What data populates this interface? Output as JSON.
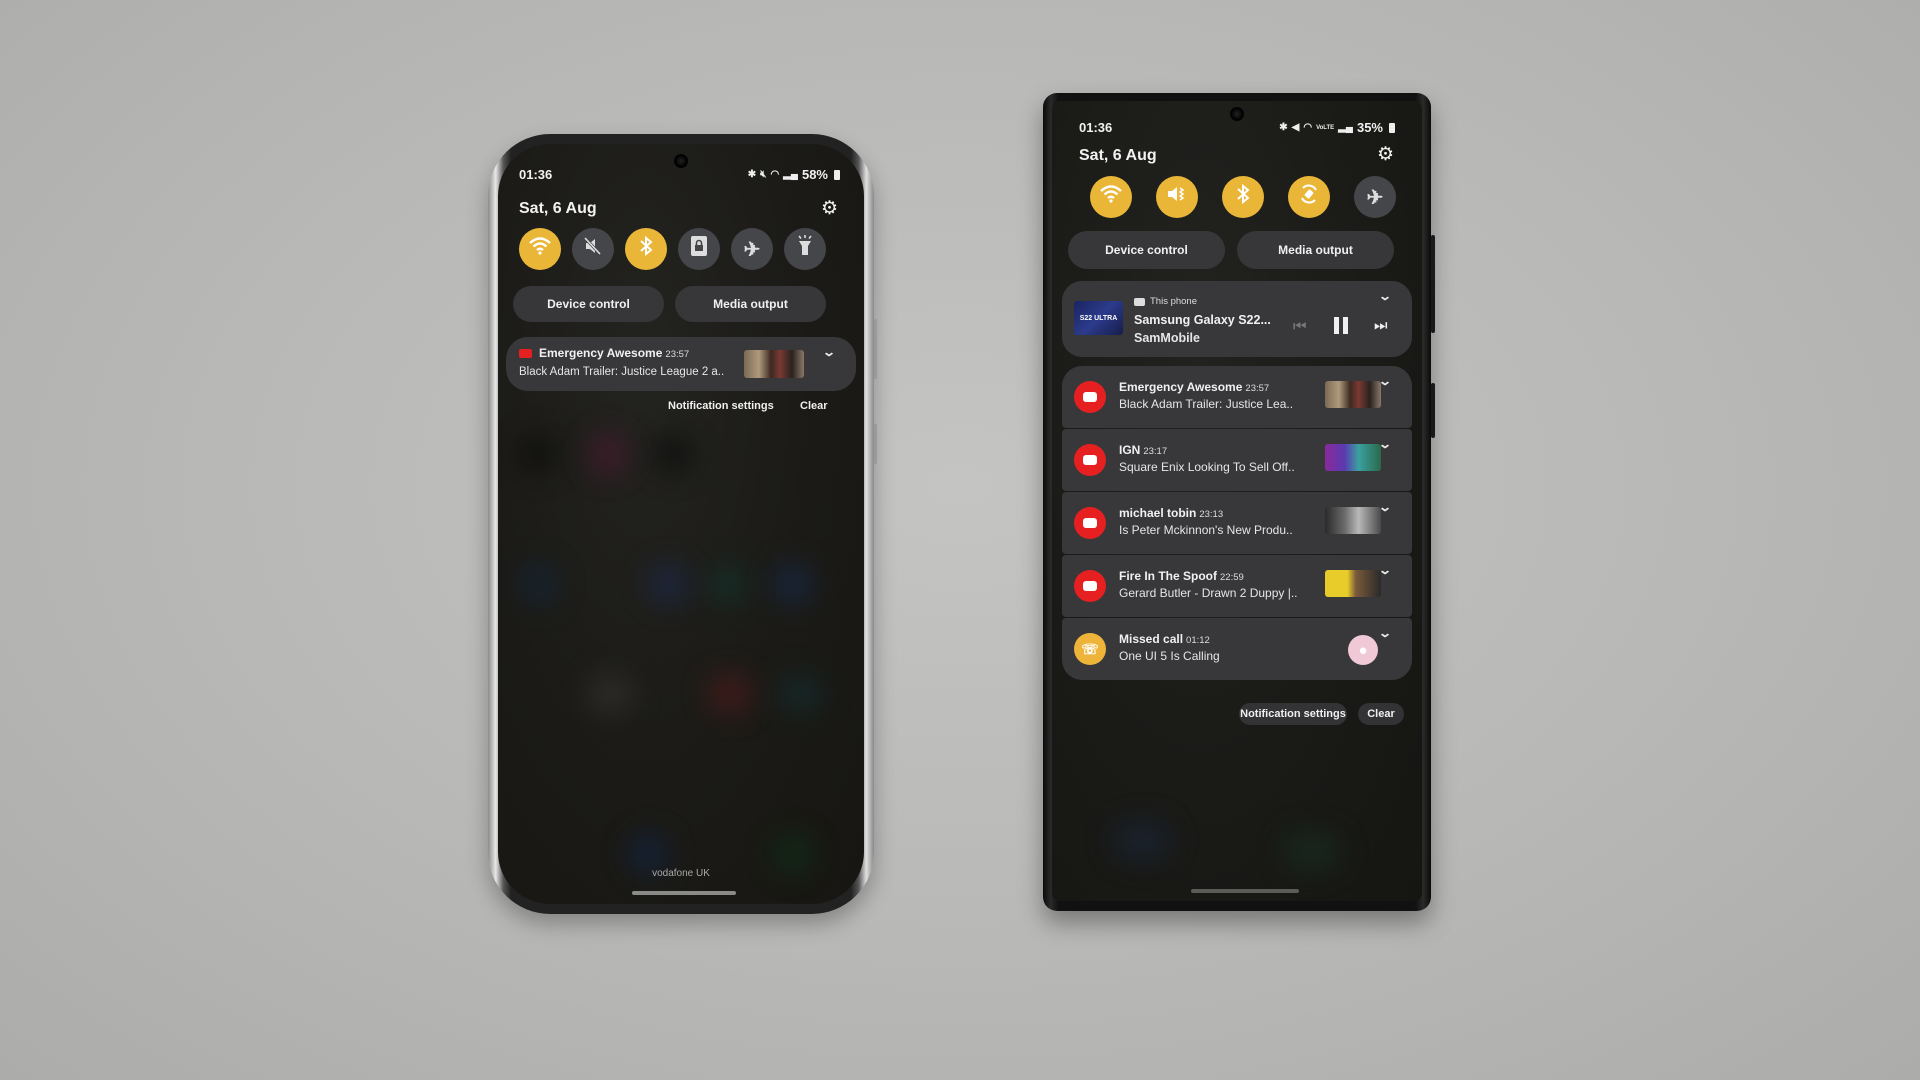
{
  "left_phone": {
    "status": {
      "time": "01:36",
      "icons": [
        "bluetooth-icon",
        "mute-icon",
        "wifi-icon",
        "signal-icon"
      ],
      "battery": "58%"
    },
    "date": "Sat, 6 Aug",
    "toggles": [
      {
        "name": "wifi",
        "glyph": "wifi",
        "on": true
      },
      {
        "name": "mute",
        "glyph": "mute",
        "on": false
      },
      {
        "name": "bluetooth",
        "glyph": "bluetooth",
        "on": true
      },
      {
        "name": "portrait-lock",
        "glyph": "lock",
        "on": false
      },
      {
        "name": "airplane",
        "glyph": "airplane",
        "on": false
      },
      {
        "name": "flashlight",
        "glyph": "flashlight",
        "on": false
      }
    ],
    "buttons": {
      "device_control": "Device control",
      "media_output": "Media output"
    },
    "notification": {
      "app": "YouTube",
      "title": "Emergency Awesome",
      "time": "23:57",
      "body": "Black Adam Trailer: Justice League 2 a.."
    },
    "actions": {
      "settings": "Notification settings",
      "clear": "Clear"
    },
    "carrier": "vodafone UK"
  },
  "right_phone": {
    "status": {
      "time": "01:36",
      "icons": [
        "bluetooth-icon",
        "vibrate-icon",
        "wifi-icon",
        "volte-icon",
        "signal-icon"
      ],
      "battery": "35%"
    },
    "date": "Sat, 6 Aug",
    "toggles": [
      {
        "name": "wifi",
        "glyph": "wifi",
        "on": true
      },
      {
        "name": "vibrate",
        "glyph": "vibrate",
        "on": true
      },
      {
        "name": "bluetooth",
        "glyph": "bluetooth",
        "on": true
      },
      {
        "name": "auto-rotate",
        "glyph": "rotate",
        "on": true
      },
      {
        "name": "airplane",
        "glyph": "airplane",
        "on": false
      }
    ],
    "buttons": {
      "device_control": "Device control",
      "media_output": "Media output"
    },
    "media": {
      "source": "This phone",
      "title": "Samsung Galaxy S22...",
      "artist": "SamMobile",
      "thumb_text": "S22 ULTRA"
    },
    "notifications": [
      {
        "title": "Emergency Awesome",
        "time": "23:57",
        "body": "Black Adam Trailer: Justice Lea..",
        "icon": "youtube"
      },
      {
        "title": "IGN",
        "time": "23:17",
        "body": "Square Enix Looking To Sell Off..",
        "icon": "youtube"
      },
      {
        "title": "michael tobin",
        "time": "23:13",
        "body": "Is Peter Mckinnon's New Produ..",
        "icon": "youtube"
      },
      {
        "title": "Fire In The Spoof",
        "time": "22:59",
        "body": "Gerard Butler - Drawn 2 Duppy |..",
        "icon": "youtube"
      },
      {
        "title": "Missed call",
        "time": "01:12",
        "body": "One UI 5 Is Calling",
        "icon": "missed-call"
      }
    ],
    "actions": {
      "settings": "Notification settings",
      "clear": "Clear"
    }
  },
  "colors": {
    "toggle_on": "#e9b638",
    "toggle_off": "#45464a",
    "youtube_red": "#e62020",
    "missed_call": "#eeb43a",
    "card_bg": "#38383b"
  }
}
